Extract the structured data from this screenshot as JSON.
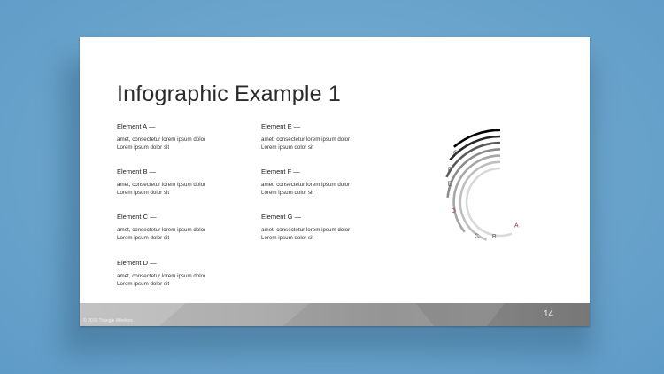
{
  "slide": {
    "title": "Infographic Example 1",
    "page_number": "14",
    "copyright": "© 2016 Triangle Wireless"
  },
  "elements": [
    {
      "title": "Element A —",
      "line1": "amet, consectetur lorem ipsum dolor",
      "line2": "Lorem ipsum dolor sit"
    },
    {
      "title": "Element B —",
      "line1": "amet, consectetur lorem ipsum dolor",
      "line2": "Lorem ipsum dolor sit"
    },
    {
      "title": "Element C —",
      "line1": "amet, consectetur lorem ipsum dolor",
      "line2": "Lorem ipsum dolor sit"
    },
    {
      "title": "Element D —",
      "line1": "amet, consectetur lorem ipsum dolor",
      "line2": "Lorem ipsum dolor sit"
    },
    {
      "title": "Element E —",
      "line1": "amet, consectetur lorem ipsum dolor",
      "line2": "Lorem ipsum dolor sit"
    },
    {
      "title": "Element F —",
      "line1": "amet, consectetur lorem ipsum dolor",
      "line2": "Lorem ipsum dolor sit"
    },
    {
      "title": "Element G —",
      "line1": "amet, consectetur lorem ipsum dolor",
      "line2": "Lorem ipsum dolor sit"
    }
  ],
  "arcs": [
    {
      "label": "A",
      "color": "#d9d9d9",
      "label_color": "#7a3b45"
    },
    {
      "label": "B",
      "color": "#bfbfbf",
      "label_color": "#555555"
    },
    {
      "label": "C",
      "color": "#a6a6a6",
      "label_color": "#555555"
    },
    {
      "label": "D",
      "color": "#8c8c8c",
      "label_color": "#7a3b45"
    },
    {
      "label": "E",
      "color": "#595959",
      "label_color": "#555555"
    },
    {
      "label": "F",
      "color": "#262626",
      "label_color": "#555555"
    },
    {
      "label": "G",
      "color": "#000000",
      "label_color": "#555555"
    }
  ]
}
